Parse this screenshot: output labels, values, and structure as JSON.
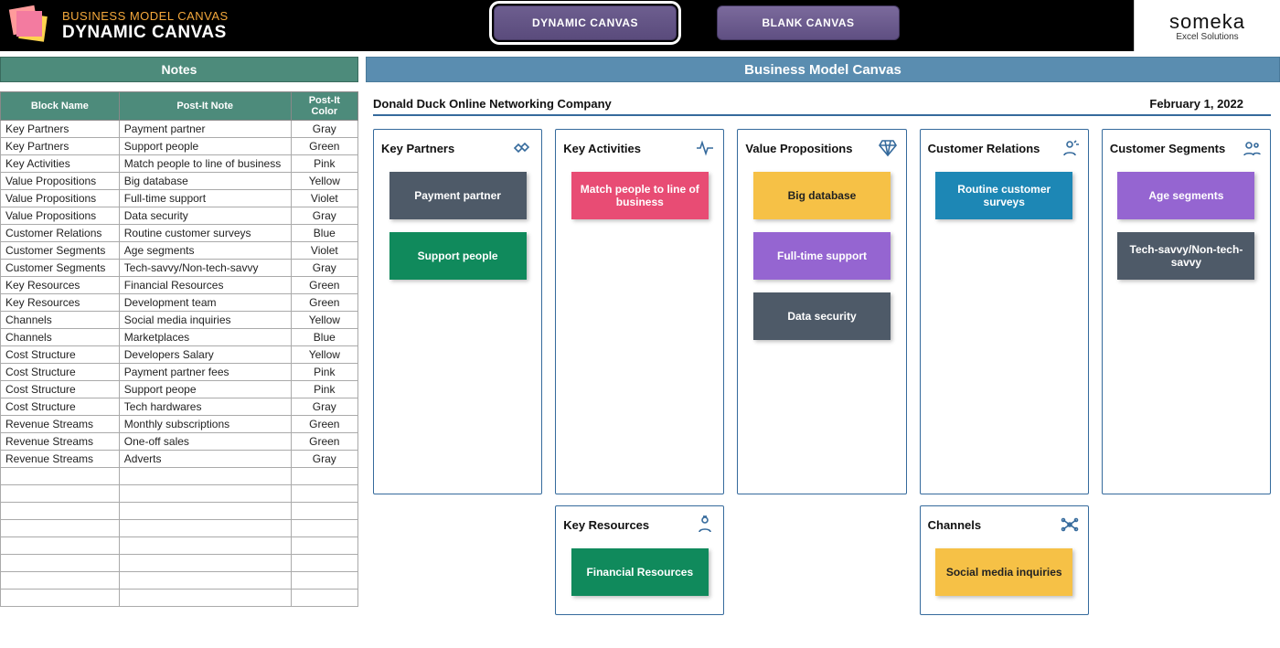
{
  "header": {
    "super_title": "BUSINESS MODEL CANVAS",
    "title": "DYNAMIC CANVAS",
    "tabs": [
      {
        "label": "DYNAMIC CANVAS",
        "active": true
      },
      {
        "label": "BLANK CANVAS",
        "active": false
      }
    ],
    "brand": {
      "name": "someka",
      "tagline": "Excel Solutions"
    }
  },
  "sections": {
    "notes_title": "Notes",
    "canvas_title": "Business Model Canvas"
  },
  "notes": {
    "columns": [
      "Block Name",
      "Post-It Note",
      "Post-It Color"
    ],
    "rows": [
      [
        "Key Partners",
        "Payment partner",
        "Gray"
      ],
      [
        "Key Partners",
        "Support people",
        "Green"
      ],
      [
        "Key Activities",
        "Match people to line of business",
        "Pink"
      ],
      [
        "Value Propositions",
        "Big database",
        "Yellow"
      ],
      [
        "Value Propositions",
        "Full-time support",
        "Violet"
      ],
      [
        "Value Propositions",
        "Data security",
        "Gray"
      ],
      [
        "Customer Relations",
        "Routine customer surveys",
        "Blue"
      ],
      [
        "Customer Segments",
        "Age segments",
        "Violet"
      ],
      [
        "Customer Segments",
        "Tech-savvy/Non-tech-savvy",
        "Gray"
      ],
      [
        "Key Resources",
        "Financial Resources",
        "Green"
      ],
      [
        "Key Resources",
        "Development team",
        "Green"
      ],
      [
        "Channels",
        "Social media inquiries",
        "Yellow"
      ],
      [
        "Channels",
        "Marketplaces",
        "Blue"
      ],
      [
        "Cost Structure",
        "Developers Salary",
        "Yellow"
      ],
      [
        "Cost Structure",
        "Payment partner fees",
        "Pink"
      ],
      [
        "Cost Structure",
        "Support peope",
        "Pink"
      ],
      [
        "Cost Structure",
        "Tech hardwares",
        "Gray"
      ],
      [
        "Revenue Streams",
        "Monthly subscriptions",
        "Green"
      ],
      [
        "Revenue Streams",
        "One-off sales",
        "Green"
      ],
      [
        "Revenue Streams",
        "Adverts",
        "Gray"
      ]
    ],
    "empty_rows": 8
  },
  "canvas": {
    "company": "Donald Duck Online Networking Company",
    "date": "February 1, 2022",
    "blocks": {
      "key_partners": {
        "title": "Key Partners",
        "stickers": [
          {
            "text": "Payment partner",
            "color": "gray"
          },
          {
            "text": "Support people",
            "color": "green"
          }
        ]
      },
      "key_activities": {
        "title": "Key Activities",
        "stickers": [
          {
            "text": "Match people to line of business",
            "color": "pink"
          }
        ]
      },
      "key_resources": {
        "title": "Key Resources",
        "stickers": [
          {
            "text": "Financial Resources",
            "color": "green"
          }
        ]
      },
      "value_propositions": {
        "title": "Value Propositions",
        "stickers": [
          {
            "text": "Big database",
            "color": "yellow"
          },
          {
            "text": "Full-time support",
            "color": "violet"
          },
          {
            "text": "Data security",
            "color": "gray"
          }
        ]
      },
      "customer_relations": {
        "title": "Customer Relations",
        "stickers": [
          {
            "text": "Routine customer surveys",
            "color": "blue"
          }
        ]
      },
      "channels": {
        "title": "Channels",
        "stickers": [
          {
            "text": "Social media inquiries",
            "color": "yellow"
          }
        ]
      },
      "customer_segments": {
        "title": "Customer Segments",
        "stickers": [
          {
            "text": "Age segments",
            "color": "violet"
          },
          {
            "text": "Tech-savvy/Non-tech-savvy",
            "color": "gray"
          }
        ]
      }
    }
  }
}
